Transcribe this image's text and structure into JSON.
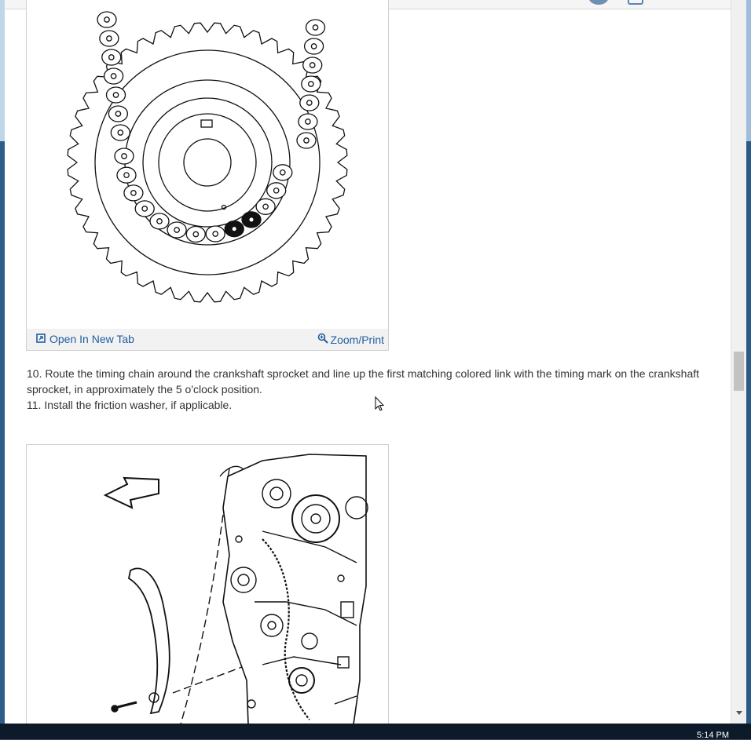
{
  "toolbar": {
    "avatar_icon": "user-avatar-icon",
    "menu_icon": "document-icon"
  },
  "figure1": {
    "icon": "timing-chain-crankshaft-sprocket-diagram",
    "open_tab_label": "Open In New Tab",
    "zoom_label": "Zoom/Print"
  },
  "instructions": {
    "step10": "10. Route the timing chain around the crankshaft sprocket and line up the first matching colored link with the timing mark on the crankshaft sprocket, in approximately the 5 o'clock position.",
    "step11": "11. Install the friction washer, if applicable."
  },
  "figure2": {
    "icon": "engine-chain-guide-install-diagram"
  },
  "taskbar": {
    "clock": "5:14 PM"
  }
}
